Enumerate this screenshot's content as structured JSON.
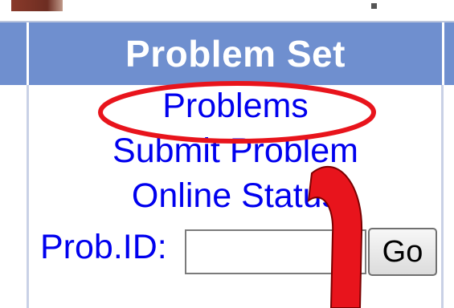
{
  "panel": {
    "title": "Problem Set",
    "links": {
      "problems": "Problems",
      "submit": "Submit Problem",
      "status": "Online Status"
    }
  },
  "search": {
    "label": "Prob.ID:",
    "value": "",
    "button_label": "Go"
  },
  "annotation": {
    "color": "#e8141c",
    "shapes": [
      "ellipse-highlight",
      "curved-arrow"
    ]
  },
  "colors": {
    "header_bg": "#6f8fcf",
    "link": "#0000ee"
  }
}
